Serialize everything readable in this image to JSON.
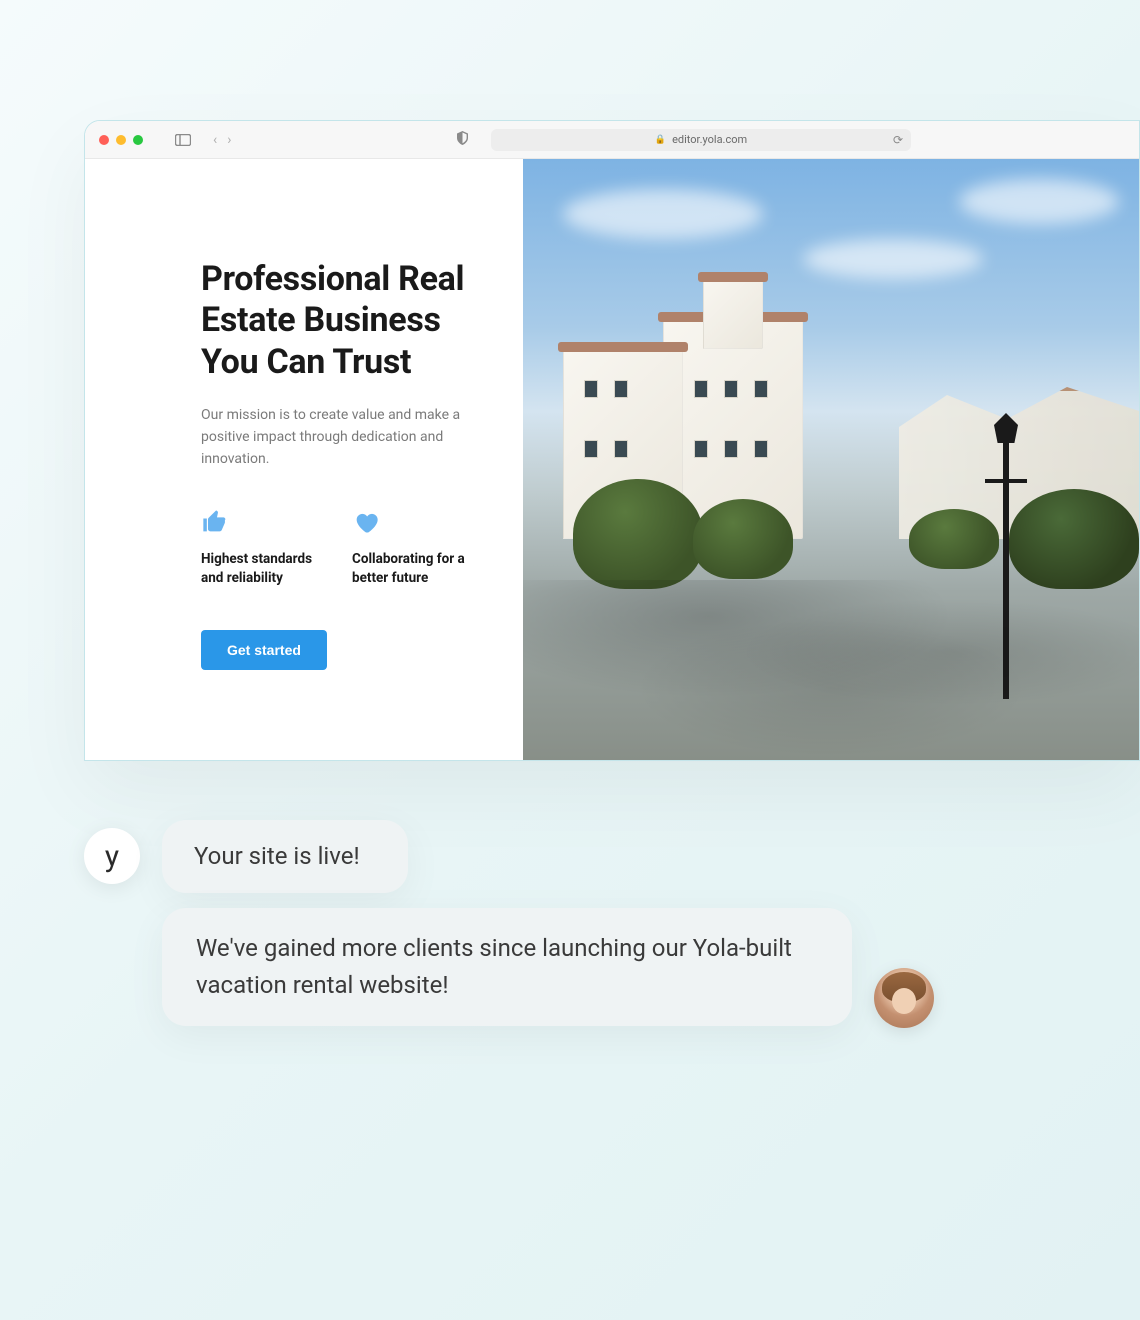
{
  "browser": {
    "url": "editor.yola.com"
  },
  "page": {
    "headline": "Professional Real Estate Business You Can Trust",
    "mission": "Our mission is to create value and make a positive impact through dedication and innovation.",
    "features": [
      {
        "icon": "thumb-up-icon",
        "label": "Highest standards and reliability"
      },
      {
        "icon": "heart-icon",
        "label": "Collaborating for a better future"
      }
    ],
    "cta_label": "Get started"
  },
  "chat": {
    "yola_letter": "y",
    "bubble1": "Your site is live!",
    "bubble2": "We've gained more clients since launching our Yola-built vacation rental website!"
  }
}
